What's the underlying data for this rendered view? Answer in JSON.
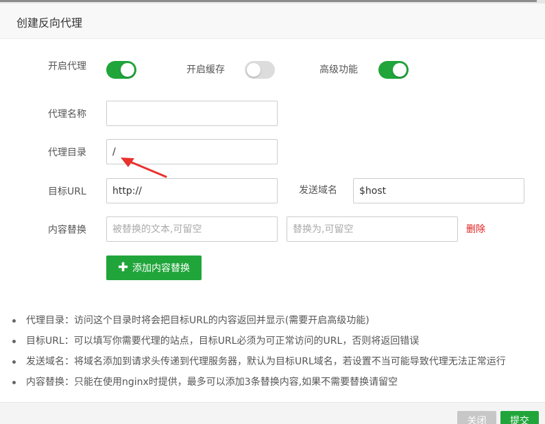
{
  "dialog": {
    "title": "创建反向代理"
  },
  "toggles": [
    {
      "label": "开启代理",
      "state": "on"
    },
    {
      "label": "开启缓存",
      "state": "off"
    },
    {
      "label": "高级功能",
      "state": "on"
    }
  ],
  "form": {
    "proxy_name": {
      "label": "代理名称",
      "value": "",
      "placeholder": ""
    },
    "proxy_dir": {
      "label": "代理目录",
      "value": "/"
    },
    "target_url": {
      "label": "目标URL",
      "value": "http://"
    },
    "send_domain": {
      "label": "发送域名",
      "value": "$host"
    },
    "content_replace": {
      "label": "内容替换",
      "from_placeholder": "被替换的文本,可留空",
      "to_placeholder": "替换为,可留空",
      "delete_label": "删除"
    },
    "add_button_label": "添加内容替换"
  },
  "tips": [
    "代理目录：访问这个目录时将会把目标URL的内容返回并显示(需要开启高级功能)",
    "目标URL：可以填写你需要代理的站点，目标URL必须为可正常访问的URL，否则将返回错误",
    "发送域名：将域名添加到请求头传递到代理服务器，默认为目标URL域名，若设置不当可能导致代理无法正常运行",
    "内容替换：只能在使用nginx时提供，最多可以添加3条替换内容,如果不需要替换请留空"
  ],
  "footer": {
    "close_label": "关闭",
    "submit_label": "提交"
  },
  "colors": {
    "accent": "#20a53a",
    "danger": "#e02020",
    "arrow": "#e8322e"
  }
}
